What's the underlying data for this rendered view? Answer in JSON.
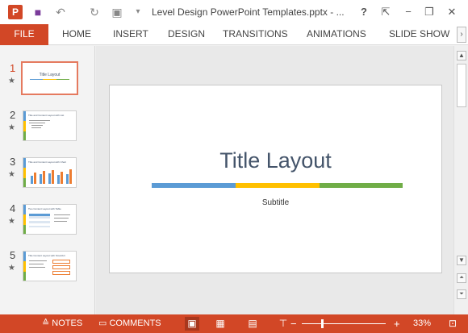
{
  "app": {
    "icon_letter": "P"
  },
  "window": {
    "title": "Level Design PowerPoint Templates.pptx - ...",
    "help": "?",
    "minimize": "−",
    "restore": "❐",
    "close": "✕"
  },
  "quick_access": {
    "save": "■",
    "undo": "↶",
    "redo": "↻",
    "present": "▣",
    "more": "▾"
  },
  "ribbon": {
    "tabs": [
      "FILE",
      "HOME",
      "INSERT",
      "DESIGN",
      "TRANSITIONS",
      "ANIMATIONS",
      "SLIDE SHOW"
    ],
    "scroll": "›"
  },
  "thumbnails": [
    {
      "number": "1",
      "star": "★",
      "title": "Title Layout"
    },
    {
      "number": "2",
      "star": "★",
      "title": "Title and Content Layout with List"
    },
    {
      "number": "3",
      "star": "★",
      "title": "Title and Content Layout with Chart"
    },
    {
      "number": "4",
      "star": "★",
      "title": "Two Content Layout with Table"
    },
    {
      "number": "5",
      "star": "★",
      "title": "Title Content Layout with SmartArt"
    }
  ],
  "slide": {
    "title": "Title Layout",
    "subtitle": "Subtitle",
    "colors": {
      "blue": "#5b9bd5",
      "yellow": "#ffc000",
      "green": "#70ad47"
    }
  },
  "scrollbar": {
    "up": "▲",
    "down": "▼"
  },
  "status": {
    "notes": "NOTES",
    "comments": "COMMENTS",
    "zoom_minus": "−",
    "zoom_plus": "+",
    "zoom_level": "33%"
  }
}
